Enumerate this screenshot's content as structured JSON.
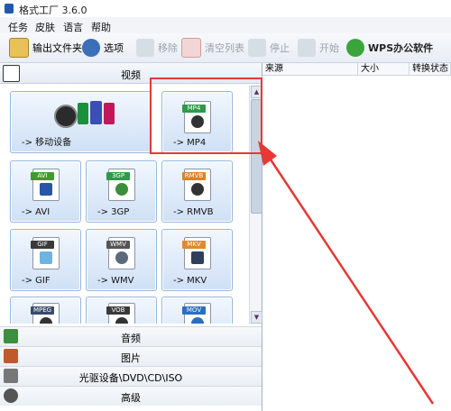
{
  "window": {
    "title": "格式工厂 3.6.0"
  },
  "menu": {
    "items": [
      "任务",
      "皮肤",
      "语言",
      "帮助"
    ]
  },
  "toolbar": {
    "output_folder": "输出文件夹",
    "options": "选项",
    "remove": "移除",
    "clear_list": "清空列表",
    "stop": "停止",
    "start": "开始",
    "wps": "WPS办公软件"
  },
  "categories": {
    "video": "视频",
    "audio": "音频",
    "image": "图片",
    "disc": "光驱设备\\DVD\\CD\\ISO",
    "advanced": "高级"
  },
  "tiles": [
    {
      "label": "-> 移动设备",
      "badge": ""
    },
    {
      "label": "-> MP4",
      "badge": "MP4"
    },
    {
      "label": "-> AVI",
      "badge": "AVI"
    },
    {
      "label": "-> 3GP",
      "badge": "3GP"
    },
    {
      "label": "-> RMVB",
      "badge": "RMVB"
    },
    {
      "label": "-> GIF",
      "badge": "GIF"
    },
    {
      "label": "-> WMV",
      "badge": "WMV"
    },
    {
      "label": "-> MKV",
      "badge": "MKV"
    },
    {
      "label": "",
      "badge": "MPEG"
    },
    {
      "label": "",
      "badge": "VOB"
    },
    {
      "label": "",
      "badge": "MOV"
    }
  ],
  "columns": [
    "来源",
    "大小",
    "转换状态"
  ],
  "colors": {
    "highlight": "#e53935",
    "tile_border": "#97b6db",
    "accent": "#1f5aa8"
  }
}
